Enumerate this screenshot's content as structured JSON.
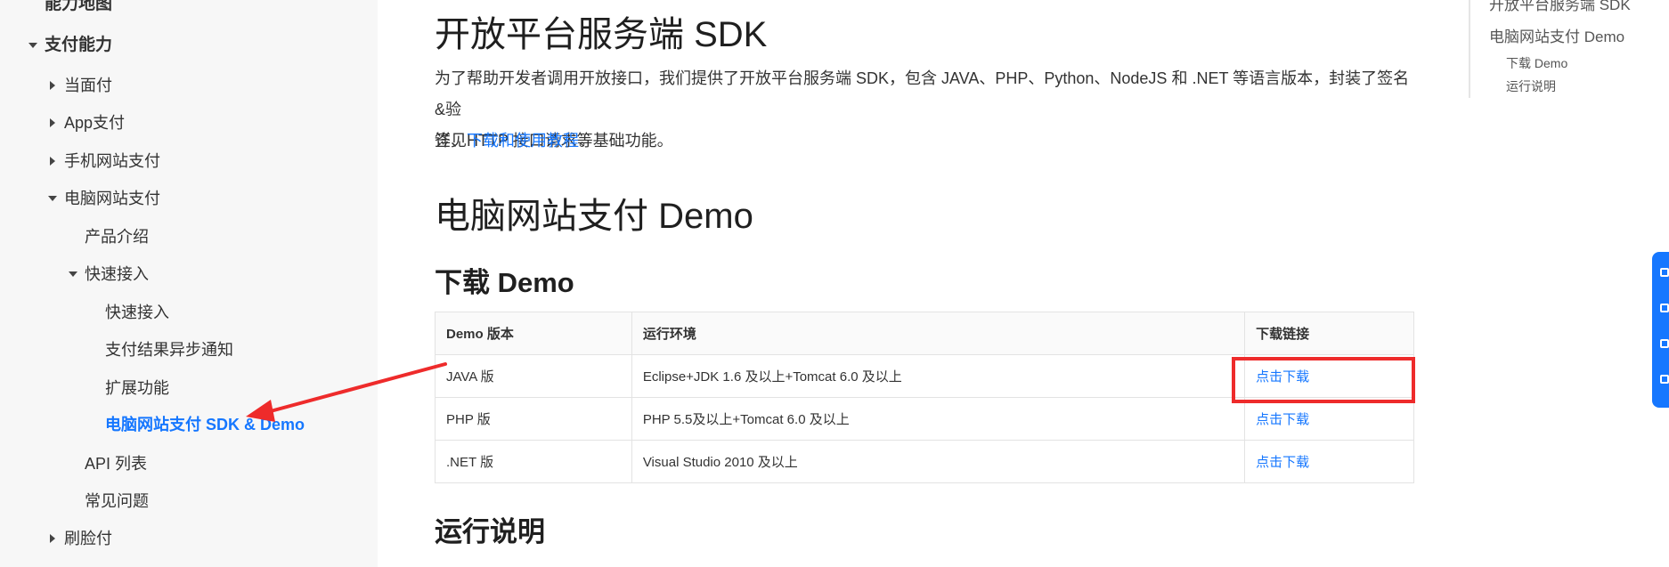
{
  "sidebar": {
    "items": [
      {
        "label": "能力地图"
      },
      {
        "label": "支付能力"
      },
      {
        "label": "当面付"
      },
      {
        "label": "App支付"
      },
      {
        "label": "手机网站支付"
      },
      {
        "label": "电脑网站支付"
      },
      {
        "label": "产品介绍"
      },
      {
        "label": "快速接入"
      },
      {
        "label": "快速接入"
      },
      {
        "label": "支付结果异步通知"
      },
      {
        "label": "扩展功能"
      },
      {
        "label": "电脑网站支付 SDK & Demo"
      },
      {
        "label": "API 列表"
      },
      {
        "label": "常见问题"
      },
      {
        "label": "刷脸付"
      }
    ]
  },
  "main": {
    "sdk_title": "开放平台服务端 SDK",
    "sdk_desc_line1": "为了帮助开发者调用开放接口，我们提供了开放平台服务端 SDK，包含 JAVA、PHP、Python、NodeJS 和 .NET 等语言版本，封装了签名&验",
    "sdk_desc_line2": "签、HTTP 接口请求等基础功能。",
    "see_prefix": "详见",
    "see_link": "下载和使用教程",
    "see_suffix": "。",
    "demo_title": "电脑网站支付 Demo",
    "download_title": "下载 Demo",
    "run_title": "运行说明"
  },
  "table": {
    "headers": [
      "Demo 版本",
      "运行环境",
      "下载链接"
    ],
    "rows": [
      {
        "version": "JAVA 版",
        "env": "Eclipse+JDK 1.6 及以上+Tomcat 6.0 及以上",
        "link": "点击下载"
      },
      {
        "version": "PHP 版",
        "env": "PHP 5.5及以上+Tomcat 6.0 及以上",
        "link": "点击下载"
      },
      {
        "version": ".NET 版",
        "env": "Visual Studio 2010 及以上",
        "link": "点击下载"
      }
    ]
  },
  "toc": {
    "items": [
      {
        "label": "开放平台服务端 SDK"
      },
      {
        "label": "电脑网站支付 Demo"
      },
      {
        "label": "下载 Demo"
      },
      {
        "label": "运行说明"
      }
    ]
  },
  "colors": {
    "accent": "#1677ff",
    "annotation": "#ee2b2b",
    "sidebar_bg": "#f7f7f7"
  },
  "icons": {
    "expand": "caret-right-icon",
    "collapse": "caret-down-icon",
    "annotation_arrow": "arrow-icon"
  }
}
